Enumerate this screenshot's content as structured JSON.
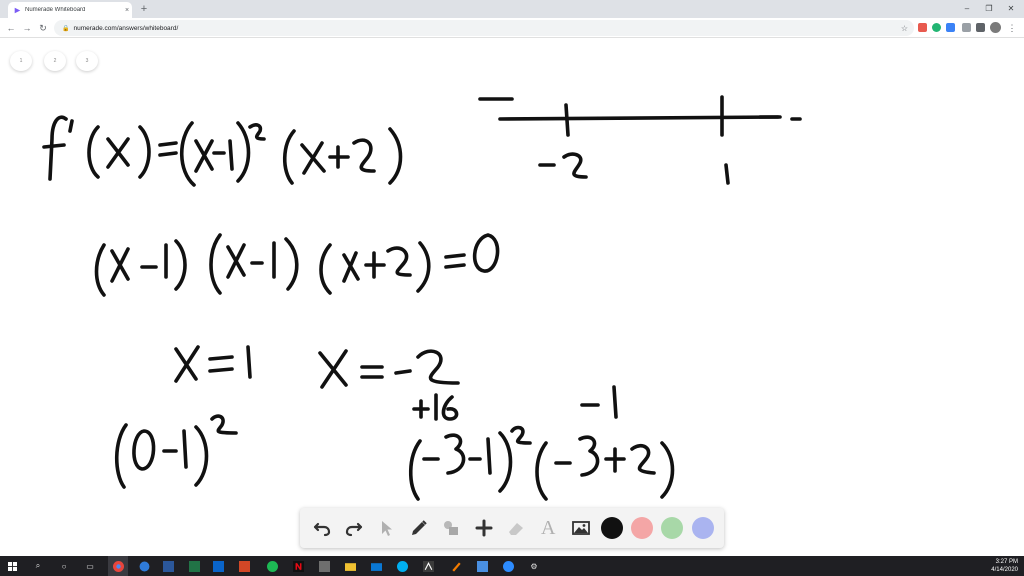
{
  "browser": {
    "tab_title": "Numerade Whiteboard",
    "tab_close": "×",
    "new_tab": "+",
    "url": "numerade.com/answers/whiteboard/",
    "window_controls": {
      "minimize": "–",
      "maximize": "❐",
      "close": "✕"
    }
  },
  "page_tabs": [
    "1",
    "2",
    "3"
  ],
  "whiteboard_icon": "handwritten-math-strokes",
  "toolbar_tools": [
    "undo-icon",
    "redo-icon",
    "select-icon",
    "pen-icon",
    "shapes-icon",
    "add-icon",
    "eraser-icon",
    "text-icon",
    "image-icon"
  ],
  "text_tool_glyph": "A",
  "colors": {
    "black": "#111111",
    "red": "#f4a6a6",
    "green": "#a8d8a8",
    "blue": "#aab4f0",
    "ink": "#111111"
  },
  "taskbar": {
    "time": "3:27 PM",
    "date": "4/14/2020"
  }
}
